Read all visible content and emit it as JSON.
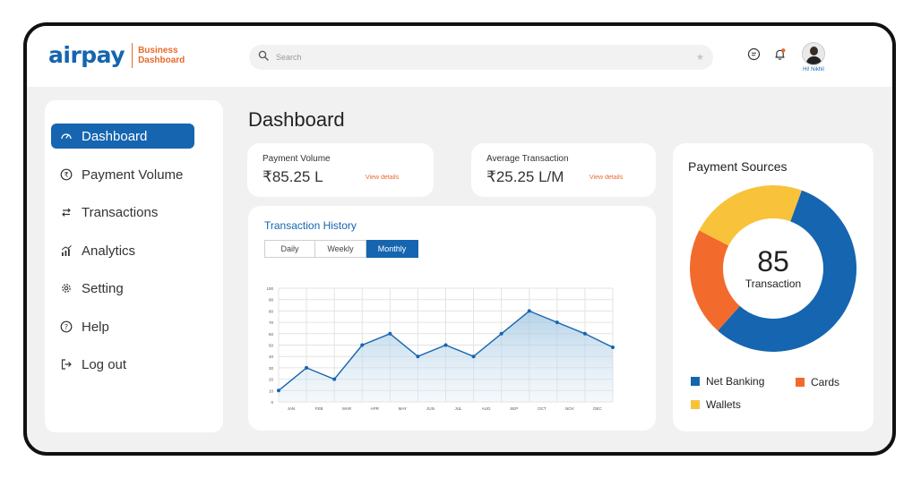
{
  "brand": {
    "logo": "airpay",
    "sub_line1": "Business",
    "sub_line2": "Dashboard",
    "accent": "#1565b0",
    "orange": "#e8692b"
  },
  "search": {
    "placeholder": "Search"
  },
  "header": {
    "greeting": "Hi! Nikhil"
  },
  "sidebar": {
    "items": [
      {
        "label": "Dashboard",
        "icon": "gauge-icon",
        "active": true
      },
      {
        "label": "Payment Volume",
        "icon": "rupee-icon"
      },
      {
        "label": "Transactions",
        "icon": "exchange-icon"
      },
      {
        "label": "Analytics",
        "icon": "analytics-icon"
      },
      {
        "label": "Setting",
        "icon": "gear-icon"
      },
      {
        "label": "Help",
        "icon": "help-icon"
      },
      {
        "label": "Log out",
        "icon": "logout-icon"
      }
    ]
  },
  "main": {
    "title": "Dashboard",
    "payment_volume": {
      "label": "Payment Volume",
      "value": "₹85.25 L",
      "link": "View details"
    },
    "avg_transaction": {
      "label": "Average Transaction",
      "value": "₹25.25 L/M",
      "link": "View details"
    },
    "history": {
      "title": "Transaction History",
      "tabs": [
        "Daily",
        "Weekly",
        "Monthly"
      ],
      "active_tab": "Monthly"
    }
  },
  "sources": {
    "title": "Payment Sources",
    "center_value": "85",
    "center_label": "Transaction",
    "legend": [
      {
        "label": "Net Banking",
        "color": "#1565b0"
      },
      {
        "label": "Cards",
        "color": "#f26a2c"
      },
      {
        "label": "Wallets",
        "color": "#f8c23a"
      }
    ]
  },
  "chart_data": [
    {
      "type": "area",
      "categories": [
        "JAN",
        "FEB",
        "MAR",
        "APR",
        "MAY",
        "JUN",
        "JUL",
        "AUG",
        "SEP",
        "OCT",
        "NOV",
        "DEC"
      ],
      "y_ticks": [
        "0",
        "10",
        "20",
        "30",
        "40",
        "50",
        "60",
        "70",
        "80",
        "90",
        "100"
      ],
      "values": [
        10,
        30,
        20,
        50,
        60,
        40,
        50,
        40,
        60,
        80,
        70,
        60,
        48
      ],
      "ylim": [
        0,
        100
      ],
      "grid": true,
      "color": "#1565b0"
    },
    {
      "type": "pie",
      "donut": true,
      "labels": [
        "Net Banking",
        "Cards",
        "Wallets"
      ],
      "values": [
        56,
        21,
        23
      ],
      "colors": [
        "#1565b0",
        "#f26a2c",
        "#f8c23a"
      ]
    }
  ]
}
